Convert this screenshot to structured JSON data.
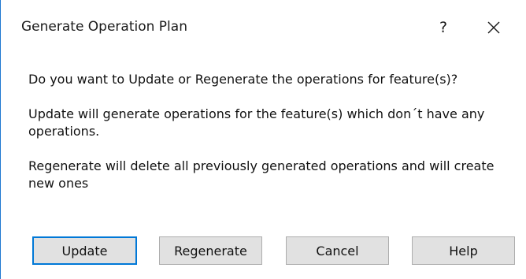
{
  "window": {
    "title": "Generate Operation Plan",
    "help_glyph": "?",
    "close_icon": "close-icon"
  },
  "message": {
    "line1": "Do you want to Update or Regenerate the operations for feature(s)?",
    "line2": "Update will generate operations for the feature(s) which don´t have any operations.",
    "line3": "Regenerate will  delete all previously generated operations and will create new ones"
  },
  "buttons": {
    "update": "Update",
    "regenerate": "Regenerate",
    "cancel": "Cancel",
    "help": "Help"
  },
  "colors": {
    "accent": "#0078d7",
    "button_bg": "#e1e1e1",
    "button_border": "#adadad",
    "window_border": "#1f78d1"
  }
}
